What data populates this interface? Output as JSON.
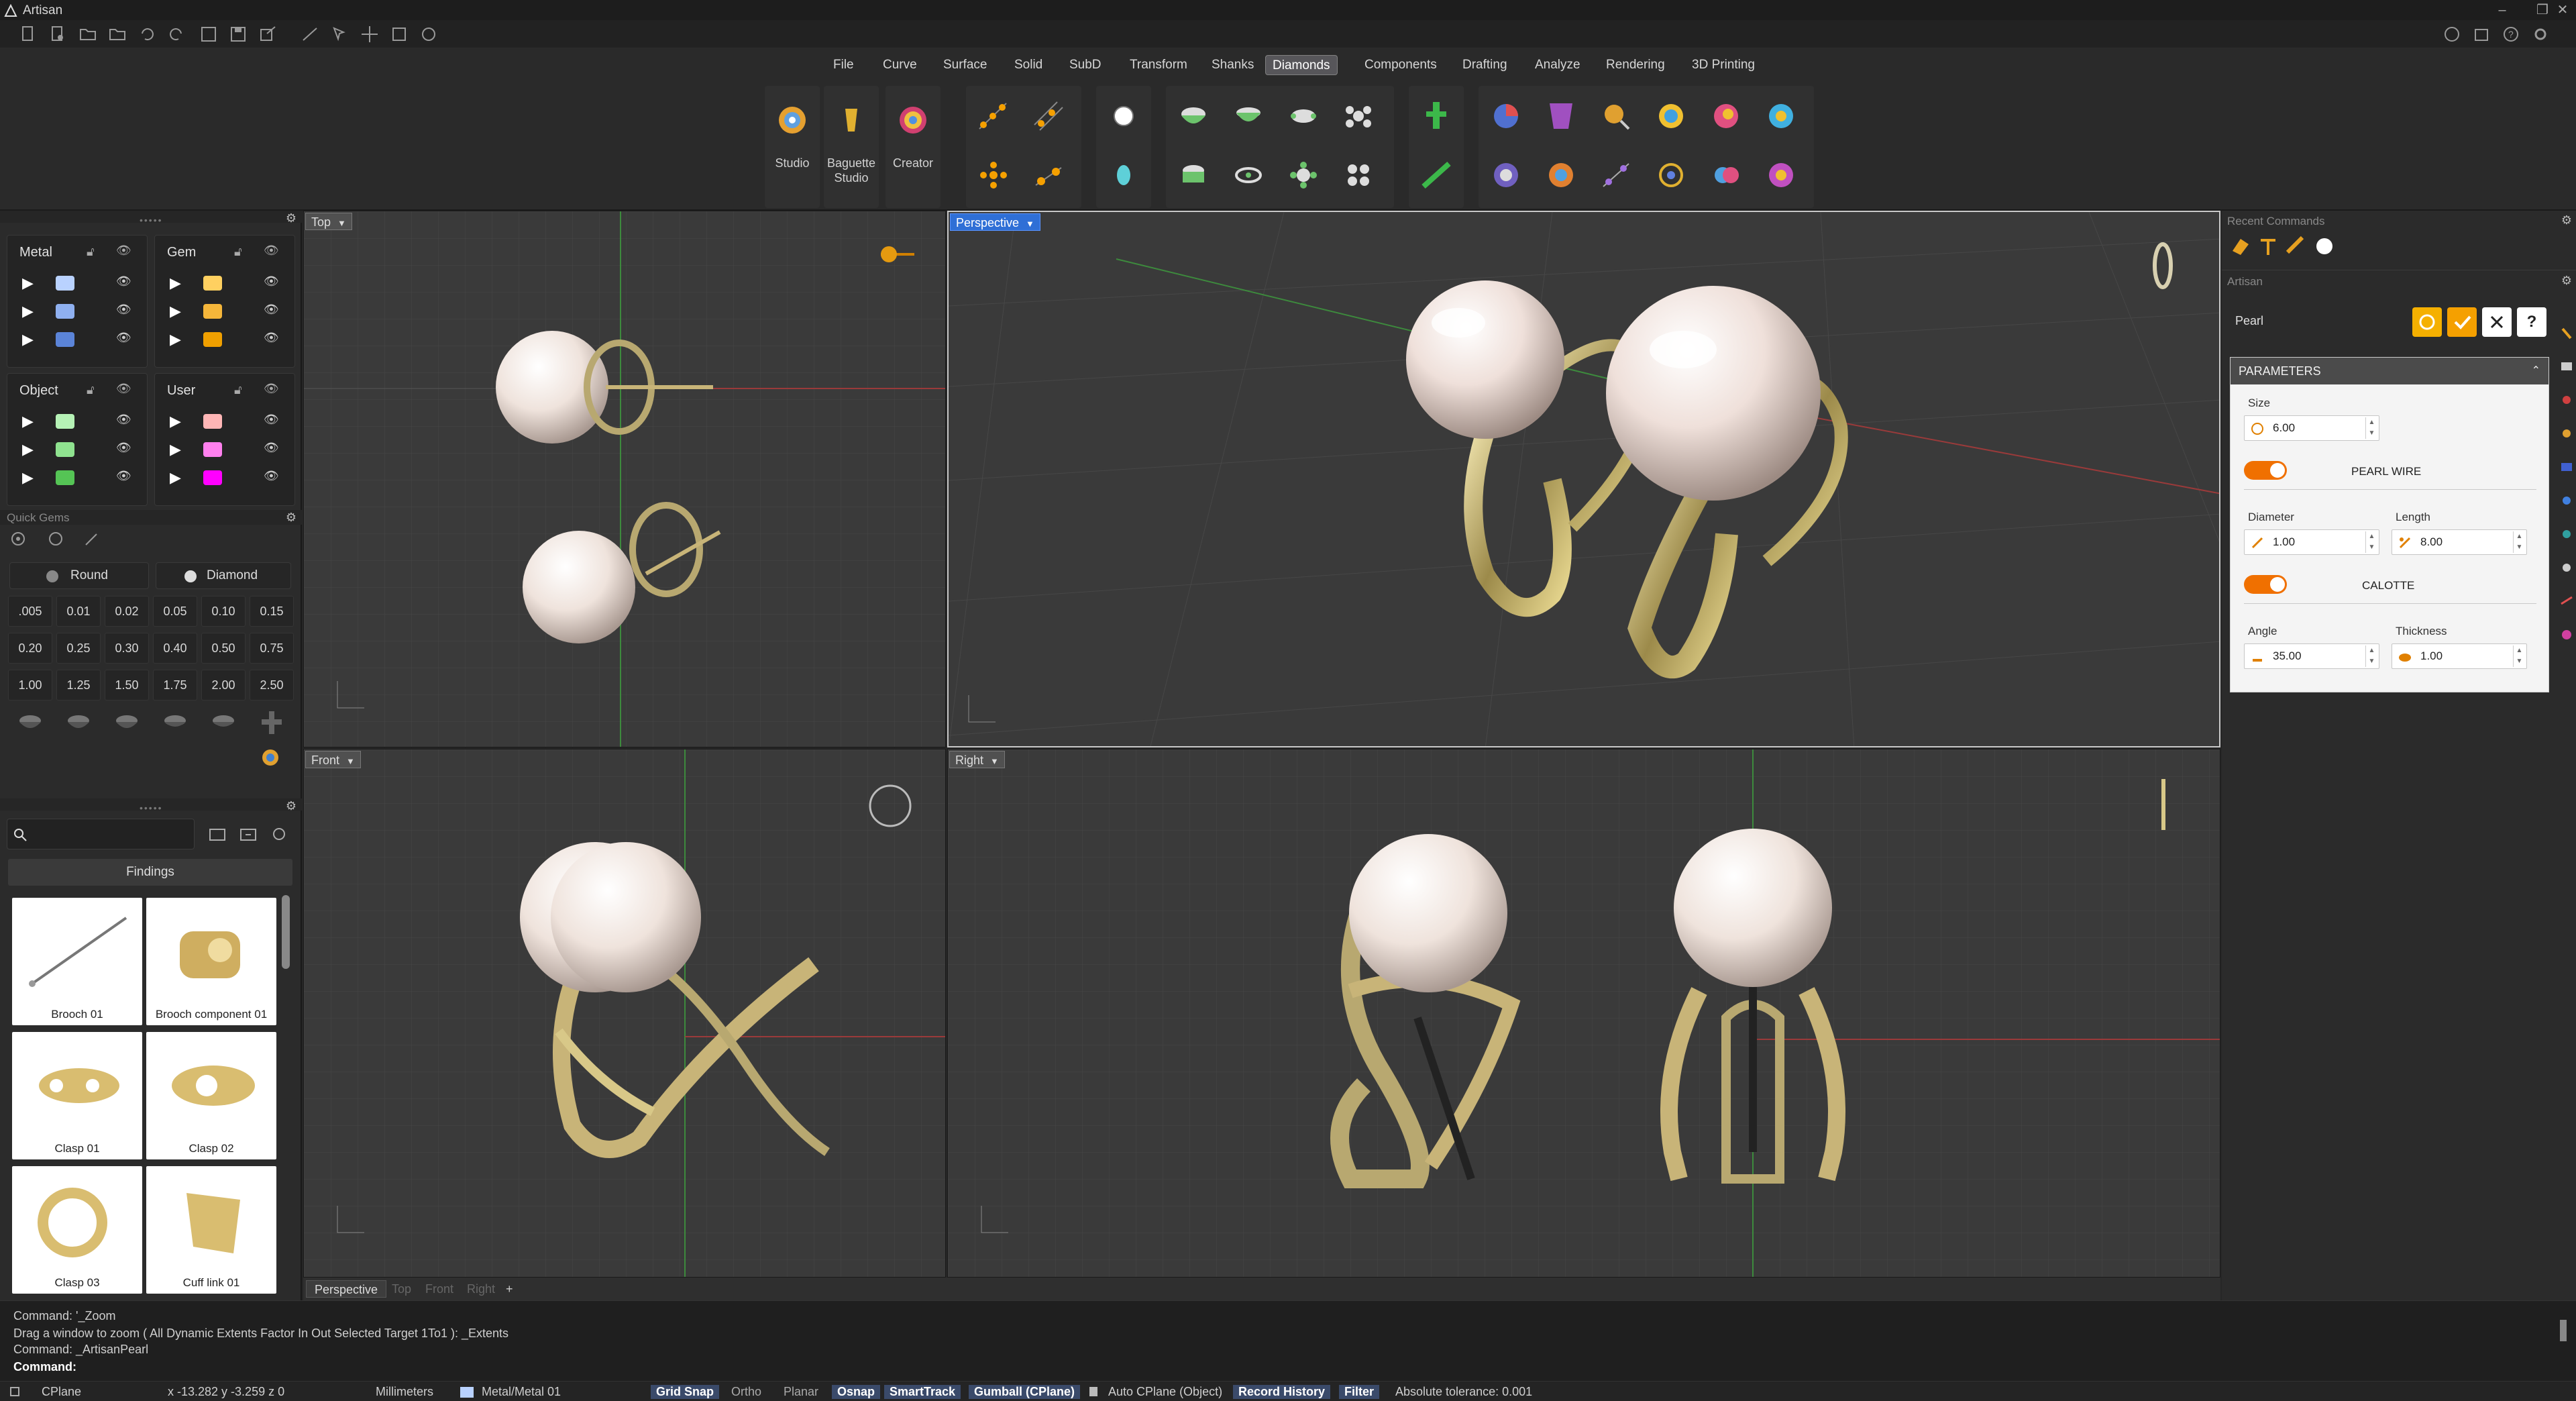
{
  "app": {
    "title": "Artisan"
  },
  "menu": [
    "File",
    "Curve",
    "Surface",
    "Solid",
    "SubD",
    "Transform",
    "Shanks",
    "Diamonds",
    "Components",
    "Drafting",
    "Analyze",
    "Rendering",
    "3D Printing"
  ],
  "menu_active": "Diamonds",
  "ribbon": {
    "studio": "Studio",
    "baguette1": "Baguette",
    "baguette2": "Studio",
    "creator": "Creator"
  },
  "layers": {
    "metal": {
      "title": "Metal",
      "colors": [
        "#b9d2ff",
        "#8fb0f0",
        "#5b84d8"
      ]
    },
    "gem": {
      "title": "Gem",
      "colors": [
        "#ffd060",
        "#f5b63a",
        "#f0a000"
      ]
    },
    "object": {
      "title": "Object",
      "colors": [
        "#b6f2b6",
        "#8fe28f",
        "#55c455"
      ]
    },
    "user": {
      "title": "User",
      "colors": [
        "#ffb6b6",
        "#ff80ee",
        "#ff00ff"
      ]
    }
  },
  "quick_gems": {
    "title": "Quick Gems",
    "shape": "Round",
    "cut": "Diamond",
    "sizes": [
      ".005",
      "0.01",
      "0.02",
      "0.05",
      "0.10",
      "0.15",
      "0.20",
      "0.25",
      "0.30",
      "0.40",
      "0.50",
      "0.75",
      "1.00",
      "1.25",
      "1.50",
      "1.75",
      "2.00",
      "2.50"
    ]
  },
  "library": {
    "category": "Findings",
    "items": [
      "Brooch 01",
      "Brooch component 01",
      "Clasp 01",
      "Clasp 02",
      "Clasp 03",
      "Cuff link 01"
    ]
  },
  "viewports": {
    "top": "Top",
    "perspective": "Perspective",
    "front": "Front",
    "right": "Right"
  },
  "viewport_tabs": [
    "Perspective",
    "Top",
    "Front",
    "Right",
    "+"
  ],
  "right_panel": {
    "recent": "Recent Commands",
    "artisan": "Artisan",
    "object_name": "Pearl",
    "parameters": "PARAMETERS",
    "size_label": "Size",
    "size": "6.00",
    "pearl_wire": "PEARL WIRE",
    "diameter_label": "Diameter",
    "diameter": "1.00",
    "length_label": "Length",
    "length": "8.00",
    "calotte": "CALOTTE",
    "angle_label": "Angle",
    "angle": "35.00",
    "thickness_label": "Thickness",
    "thickness": "1.00"
  },
  "command": {
    "lines": [
      "Command: '_Zoom",
      "Drag a window to zoom ( All  Dynamic  Extents  Factor  In  Out  Selected  Target  1To1 ): _Extents",
      "Command: _ArtisanPearl"
    ],
    "prompt": "Command:"
  },
  "status": {
    "cplane": "CPlane",
    "coords": "x -13.282  y -3.259  z 0",
    "units": "Millimeters",
    "layer": "Metal/Metal 01",
    "grid": "Grid Snap",
    "ortho": "Ortho",
    "planar": "Planar",
    "osnap": "Osnap",
    "smarttrack": "SmartTrack",
    "gumball": "Gumball (CPlane)",
    "autocplane": "Auto CPlane (Object)",
    "history": "Record History",
    "filter": "Filter",
    "tolerance": "Absolute tolerance: 0.001"
  }
}
